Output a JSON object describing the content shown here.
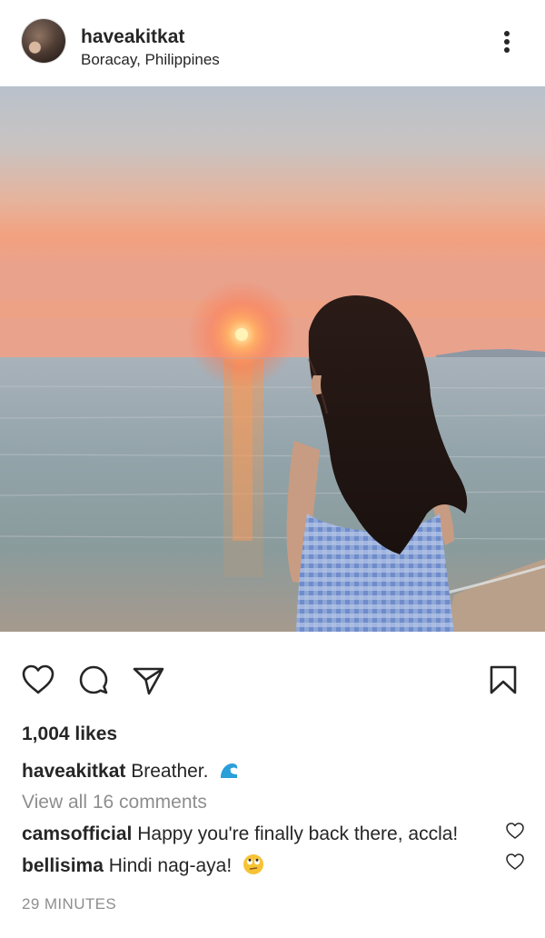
{
  "post": {
    "username": "haveakitkat",
    "location": "Boracay, Philippines",
    "likes_text": "1,004 likes",
    "caption": {
      "user": "haveakitkat",
      "text": "Breather.",
      "emoji": "wave-emoji"
    },
    "view_all_comments": "View all 16 comments",
    "comments": [
      {
        "user": "camsofficial",
        "text": "Happy you're finally back there, accla!"
      },
      {
        "user": "bellisima",
        "text": "Hindi nag-aya!",
        "emoji": "face-with-rolling-eyes-emoji"
      }
    ],
    "timestamp": "29 MINUTES"
  },
  "icons": {
    "more": "more-options-icon",
    "like": "heart-icon",
    "comment": "comment-icon",
    "share": "paper-plane-icon",
    "save": "bookmark-icon",
    "comment_like": "heart-icon"
  },
  "colors": {
    "text": "#262626",
    "secondary": "#8e8e8e",
    "background": "#ffffff"
  }
}
